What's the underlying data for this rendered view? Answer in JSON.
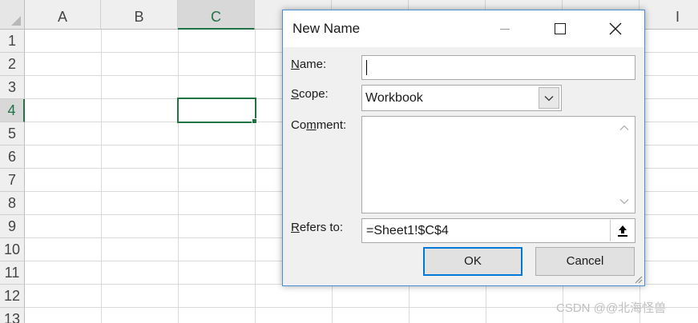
{
  "spreadsheet": {
    "columns": [
      "A",
      "B",
      "C",
      "",
      "",
      "",
      "",
      "",
      "I"
    ],
    "rows": [
      "1",
      "2",
      "3",
      "4",
      "5",
      "6",
      "7",
      "8",
      "9",
      "10",
      "11",
      "12",
      "13"
    ],
    "selected_column": "C",
    "selected_row": "4"
  },
  "dialog": {
    "title": "New Name",
    "name_label_key": "N",
    "name_label_rest": "ame:",
    "name_value": "",
    "scope_label_key": "S",
    "scope_label_rest": "cope:",
    "scope_value": "Workbook",
    "comment_label_pre": "Co",
    "comment_label_key": "m",
    "comment_label_rest": "ment:",
    "comment_value": "",
    "refers_label_key": "R",
    "refers_label_rest": "efers to:",
    "refers_value": "=Sheet1!$C$4",
    "ok_label": "OK",
    "cancel_label": "Cancel"
  },
  "watermark": {
    "text": "CSDN @@北海怪兽"
  },
  "colors": {
    "excel_green": "#217346",
    "dialog_border": "#4a8fd6",
    "focus_blue": "#0078d7"
  },
  "icons": [
    "minimize-icon",
    "maximize-icon",
    "close-icon",
    "chevron-down-icon",
    "scroll-up-arrow-icon",
    "scroll-down-arrow-icon",
    "collapse-dialog-icon",
    "resize-grip-icon"
  ]
}
